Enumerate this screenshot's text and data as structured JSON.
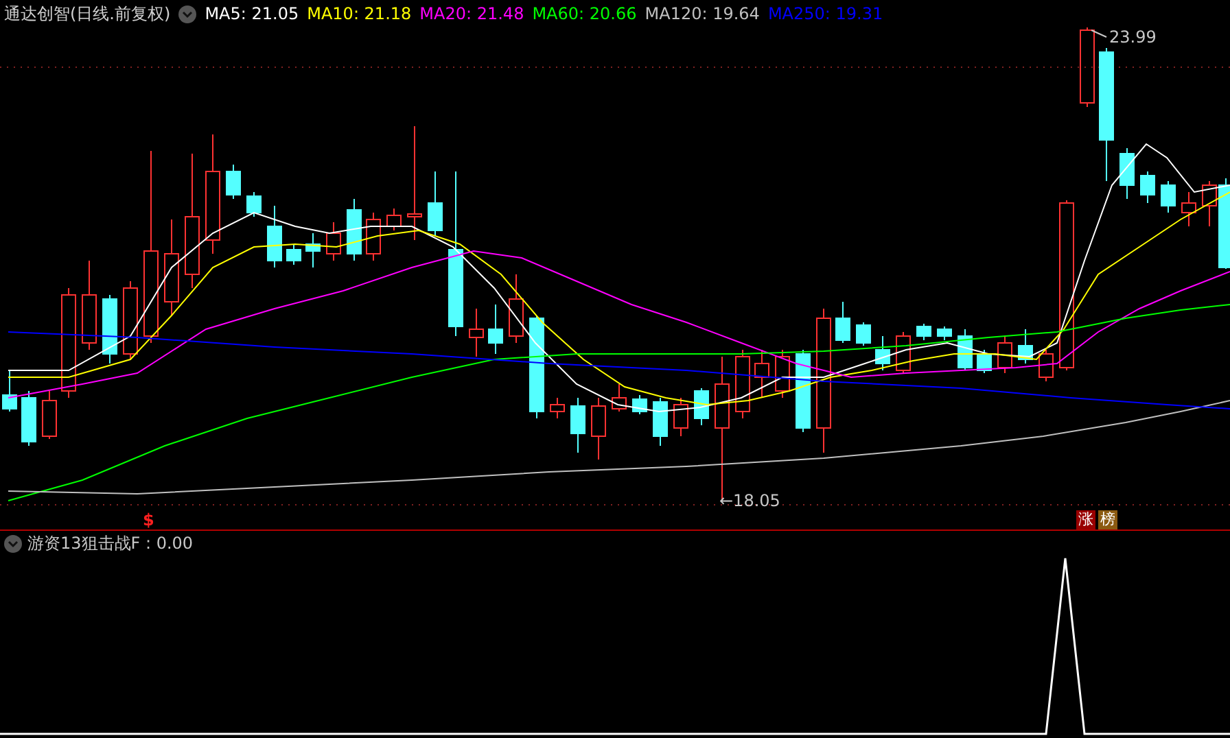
{
  "header": {
    "title": "通达创智(日线.前复权)",
    "moving_averages": [
      {
        "label": "MA5: 21.05",
        "color": "#ffffff"
      },
      {
        "label": "MA10: 21.18",
        "color": "#ffff00"
      },
      {
        "label": "MA20: 21.48",
        "color": "#ff00ff"
      },
      {
        "label": "MA60: 20.66",
        "color": "#00ff00"
      },
      {
        "label": "MA120: 19.64",
        "color": "#c0c0c0"
      },
      {
        "label": "MA250: 19.31",
        "color": "#0000ff"
      }
    ]
  },
  "price_chart": {
    "high_label": "23.99",
    "low_label": "←18.05",
    "signal_marker": "$",
    "badges": [
      {
        "text": "涨",
        "color": "#990000"
      },
      {
        "text": "榜",
        "color": "#8b5a10"
      }
    ]
  },
  "indicator": {
    "title": "游资13狙击战F : 0.00"
  }
}
